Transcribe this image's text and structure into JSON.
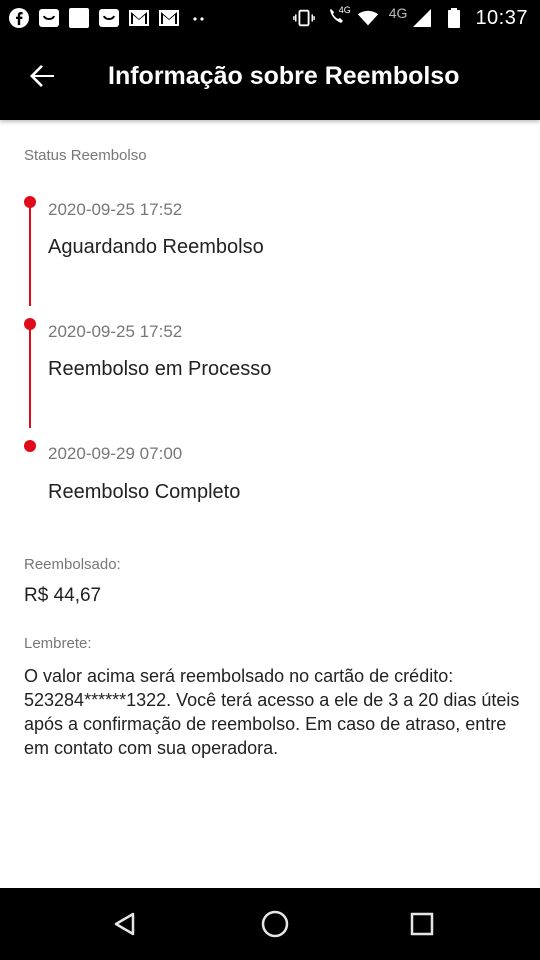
{
  "status_bar": {
    "time": "10:37",
    "network": "4G",
    "network_small": "4G",
    "notification_icons": [
      "facebook-icon",
      "shopee-icon",
      "blank-app-icon",
      "shopee-icon",
      "gmail-icon",
      "gmail-icon",
      "more-dots-icon"
    ],
    "system_icons": [
      "vibrate-icon",
      "volte-call-icon",
      "wifi-icon",
      "signal-icon",
      "battery-icon"
    ]
  },
  "header": {
    "title": "Informação sobre Reembolso",
    "back_icon": "arrow-left-icon"
  },
  "refund_status": {
    "label": "Status Reembolso",
    "steps": [
      {
        "date": "2020-09-25 17:52",
        "status": "Aguardando Reembolso"
      },
      {
        "date": "2020-09-25 17:52",
        "status": "Reembolso em Processo"
      },
      {
        "date": "2020-09-29 07:00",
        "status": "Reembolso Completo"
      }
    ]
  },
  "refunded": {
    "label": "Reembolsado:",
    "amount": "R$ 44,67"
  },
  "reminder": {
    "label": "Lembrete:",
    "text": "O valor acima será reembolsado no cartão de crédito: 523284******1322. Você terá acesso a ele de 3 a 20 dias úteis após a confirmação de reembolso. Em caso de atraso, entre em contato com sua operadora."
  },
  "colors": {
    "accent": "#e00b1a",
    "bar_bg": "#000000",
    "muted_text": "#777777"
  },
  "nav_bar": {
    "icons": [
      "back-triangle-icon",
      "home-circle-icon",
      "recents-square-icon"
    ]
  }
}
